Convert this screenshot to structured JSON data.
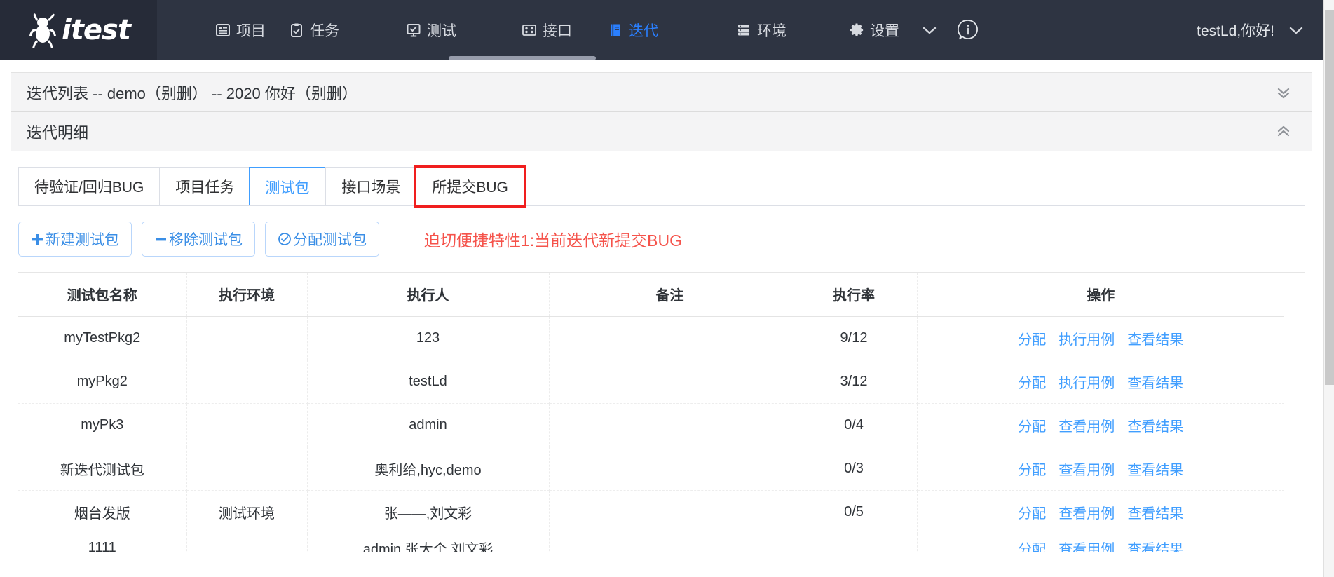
{
  "brand": {
    "name": "itest",
    "logo_icon": "bug-logo-icon"
  },
  "nav": {
    "items": [
      {
        "label": "项目",
        "icon": "project-icon",
        "active": false
      },
      {
        "label": "任务",
        "icon": "task-clipboard-icon",
        "active": false
      },
      {
        "label": "测试",
        "icon": "test-monitor-icon",
        "active": false
      },
      {
        "label": "接口",
        "icon": "api-grid-icon",
        "active": false
      },
      {
        "label": "迭代",
        "icon": "iteration-book-icon",
        "active": true
      },
      {
        "label": "环境",
        "icon": "environment-server-icon",
        "active": false
      },
      {
        "label": "设置",
        "icon": "gear-icon",
        "active": false
      }
    ],
    "more_caret": "⌄",
    "info_icon": "info-bubble-icon",
    "user_greeting": "testLd,你好!",
    "user_caret": "⌄"
  },
  "breadcrumb": {
    "text": "迭代列表 -- demo（别删）  -- 2020 你好（别删）",
    "toggle_icon": "chevron-double-down-icon"
  },
  "detail_panel": {
    "title": "迭代明细",
    "toggle_icon": "chevron-double-up-icon"
  },
  "tabs": [
    {
      "label": "待验证/回归BUG",
      "active": false,
      "boxed": false
    },
    {
      "label": "项目任务",
      "active": false,
      "boxed": false
    },
    {
      "label": "测试包",
      "active": true,
      "boxed": false
    },
    {
      "label": "接口场景",
      "active": false,
      "boxed": false
    },
    {
      "label": "所提交BUG",
      "active": false,
      "boxed": true
    }
  ],
  "toolbar": {
    "buttons": [
      {
        "label": "新建测试包",
        "icon": "plus-icon",
        "glyph": "✚"
      },
      {
        "label": "移除测试包",
        "icon": "minus-icon",
        "glyph": "━"
      },
      {
        "label": "分配测试包",
        "icon": "check-circle-icon",
        "glyph": "⊘"
      }
    ],
    "annotation": "迫切便捷特性1:当前迭代新提交BUG",
    "annotation_color": "#f5534b"
  },
  "table": {
    "headers": [
      "测试包名称",
      "执行环境",
      "执行人",
      "备注",
      "执行率",
      "操作"
    ],
    "rows": [
      {
        "name": "myTestPkg2",
        "env": "",
        "executor": "123",
        "remark": "",
        "rate": "9/12",
        "actions": [
          "分配",
          "执行用例",
          "查看结果"
        ]
      },
      {
        "name": "myPkg2",
        "env": "",
        "executor": "testLd",
        "remark": "",
        "rate": "3/12",
        "actions": [
          "分配",
          "执行用例",
          "查看结果"
        ]
      },
      {
        "name": "myPk3",
        "env": "",
        "executor": "admin",
        "remark": "",
        "rate": "0/4",
        "actions": [
          "分配",
          "查看用例",
          "查看结果"
        ]
      },
      {
        "name": "新迭代测试包",
        "env": "",
        "executor": "奥利给,hyc,demo",
        "remark": "",
        "rate": "0/3",
        "actions": [
          "分配",
          "查看用例",
          "查看结果"
        ]
      },
      {
        "name": "烟台发版",
        "env": "测试环境",
        "executor": "张——,刘文彩",
        "remark": "",
        "rate": "0/5",
        "actions": [
          "分配",
          "查看用例",
          "查看结果"
        ]
      },
      {
        "name": "1111",
        "env": "",
        "executor": "admin,张大个,刘文彩",
        "remark": "",
        "rate": "",
        "actions": [
          "分配",
          "查看用例",
          "查看结果"
        ]
      }
    ]
  },
  "scrollbars": {
    "table_up_arrow": "▲",
    "table_down_arrow": "▼"
  },
  "colors": {
    "nav_bg": "#2e3442",
    "brand_bg": "#262b38",
    "accent_blue": "#409eff",
    "annotation_red": "#f5534b",
    "highlight_box_red": "#f01e1e"
  }
}
